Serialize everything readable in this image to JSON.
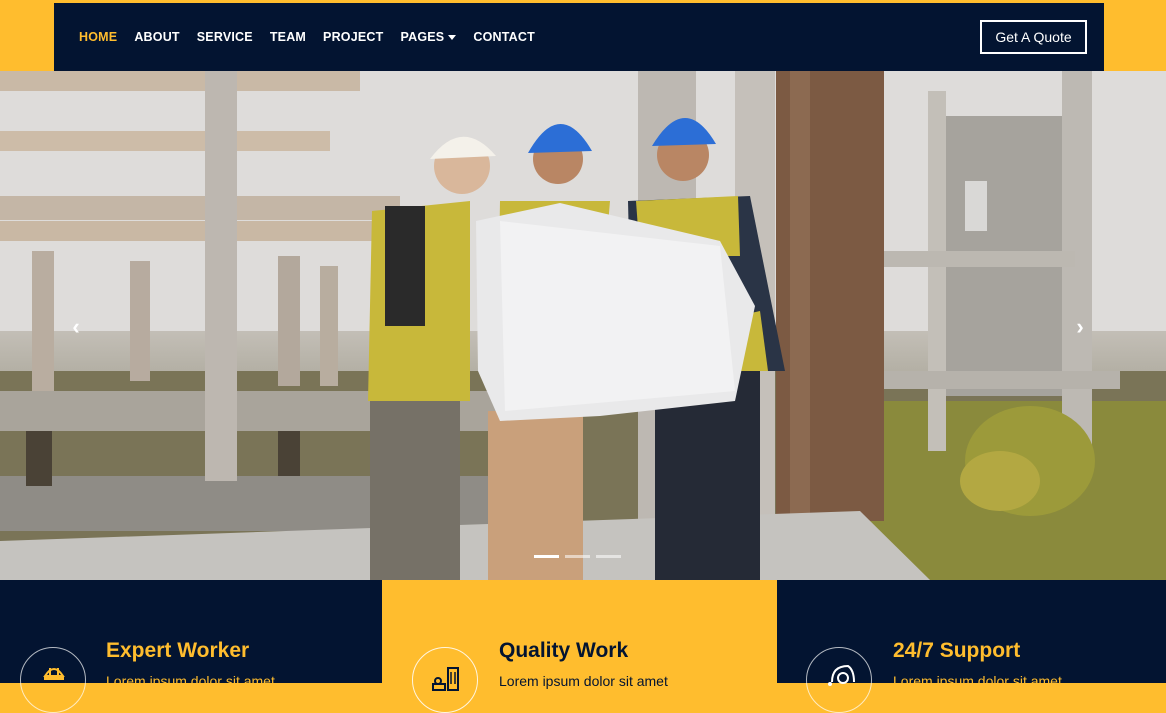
{
  "nav": {
    "items": [
      {
        "label": "HOME"
      },
      {
        "label": "ABOUT"
      },
      {
        "label": "SERVICE"
      },
      {
        "label": "TEAM"
      },
      {
        "label": "PROJECT"
      },
      {
        "label": "PAGES"
      },
      {
        "label": "CONTACT"
      }
    ],
    "quote_label": "Get A Quote"
  },
  "carousel": {
    "prev_icon": "chevron-left-icon",
    "next_icon": "chevron-right-icon",
    "indicator_count": 3,
    "active_index": 0
  },
  "features": [
    {
      "title": "Expert Worker",
      "text": "Lorem ipsum dolor sit amet",
      "icon": "worker-icon"
    },
    {
      "title": "Quality Work",
      "text": "Lorem ipsum dolor sit amet",
      "icon": "building-icon"
    },
    {
      "title": "24/7 Support",
      "text": "Lorem ipsum dolor sit amet",
      "icon": "headset-icon"
    }
  ],
  "colors": {
    "navy": "#031431",
    "accent": "#ffbd2e",
    "white": "#ffffff"
  }
}
